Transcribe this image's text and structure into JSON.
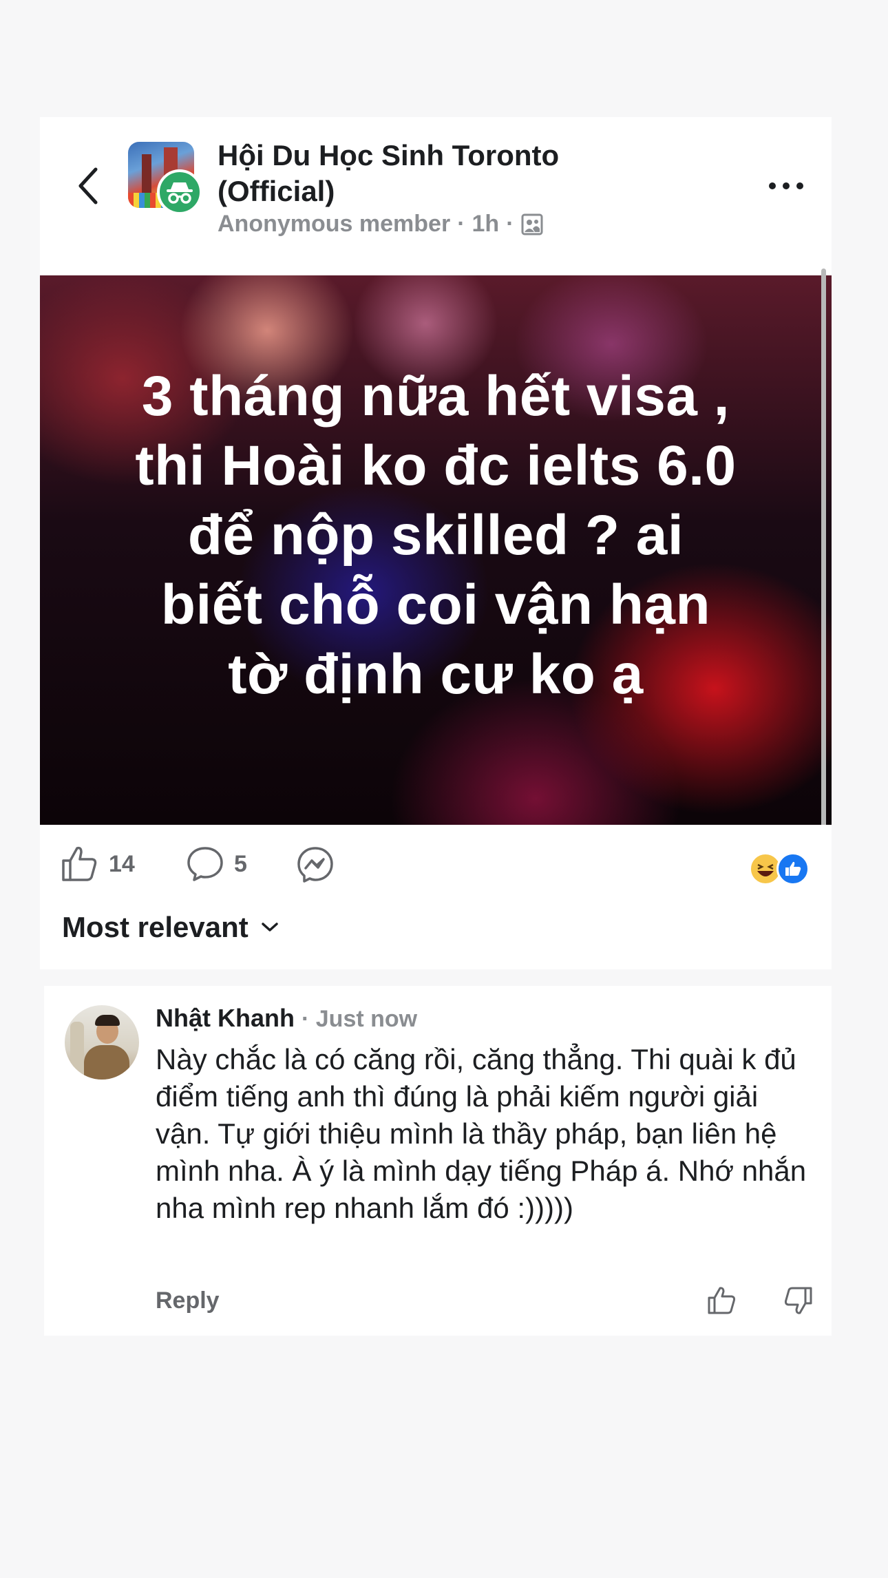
{
  "header": {
    "group_name": "Hội Du Học Sinh Toronto (Official)",
    "author": "Anonymous member",
    "separator": "·",
    "time": "1h",
    "audience_icon": "group-members-icon"
  },
  "post": {
    "text": "3 tháng nữa hết visa ,\nthi Hoài ko đc ielts 6.0\nđể nộp skilled  ? ai\nbiết chỗ coi vận hạn\ntờ định cư ko ạ"
  },
  "actions": {
    "like_count": "14",
    "comment_count": "5",
    "reactions": [
      "haha",
      "like"
    ]
  },
  "sort": {
    "label": "Most relevant"
  },
  "comment": {
    "name": "Nhật Khanh",
    "time": "· Just now",
    "text": "Này chắc là có căng rồi, căng thẳng. Thi quài k đủ điểm tiếng anh thì đúng là phải kiếm người giải vận. Tự giới thiệu mình là thầy pháp, bạn liên hệ mình nha. À ý là mình dạy tiếng Pháp á. Nhớ nhắn nha mình rep nhanh lắm đó :)))))",
    "reply_label": "Reply"
  },
  "colors": {
    "background": "#f7f7f8",
    "card": "#ffffff",
    "text": "#1c1e21",
    "muted": "#8a8d91",
    "anon_badge": "#2ea866",
    "like_blue": "#1877f2"
  }
}
